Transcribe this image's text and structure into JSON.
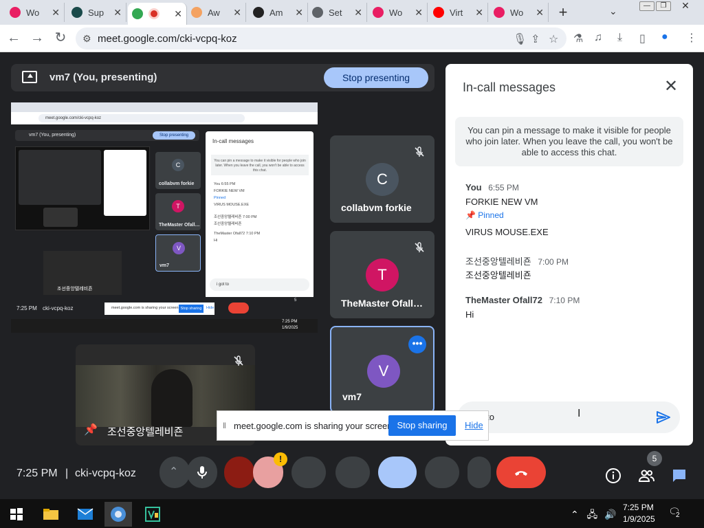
{
  "browser": {
    "tabs": [
      {
        "label": "Wo",
        "icon": "flower-icon",
        "color": "#e91e63"
      },
      {
        "label": "Sup",
        "icon": "chat-icon",
        "color": "#1a4a4a"
      },
      {
        "label": "",
        "icon": "meet-icon",
        "color": "#34a853"
      },
      {
        "label": "Aw",
        "icon": "rainbow-icon",
        "color": "#f4a261"
      },
      {
        "label": "Am",
        "icon": "amazon-icon",
        "color": "#222222"
      },
      {
        "label": "Set",
        "icon": "gear-icon",
        "color": "#5f6368"
      },
      {
        "label": "Wo",
        "icon": "flower-icon",
        "color": "#e91e63"
      },
      {
        "label": "Virt",
        "icon": "youtube-icon",
        "color": "#ff0000"
      },
      {
        "label": "Wo",
        "icon": "flower-icon",
        "color": "#e91e63"
      }
    ],
    "url": "meet.google.com/cki-vcpq-koz"
  },
  "meet": {
    "presenting_label": "vm7 (You, presenting)",
    "stop_presenting": "Stop presenting",
    "participants": [
      {
        "name": "collabvm forkie",
        "initial": "C",
        "color": "#4a5560"
      },
      {
        "name": "TheMaster Ofall…",
        "initial": "T",
        "color": "#d01563"
      },
      {
        "name": "vm7",
        "initial": "V",
        "color": "#7e57c2"
      }
    ],
    "video_caption": "조선중앙텔레비죤",
    "shared_screen": {
      "url": "meet.google.com/cki-vcpq-koz",
      "presenting_label": "vm7 (You, presenting)",
      "stop_presenting": "Stop presenting",
      "chat_title": "In-call messages",
      "chat_note": "You can pin a message to make it visible for people who join later. When you leave the call, you won't be able to access this chat.",
      "chat_lines": [
        "You  6:55 PM",
        "FORKIE NEW VM",
        "Pinned",
        "VIRUS MOUSE.EXE",
        "조선중앙텔레비죤  7:00 PM",
        "조선중앙텔레비죤",
        "TheMaster Ofall72  7:10 PM",
        "Hi"
      ],
      "chat_input": "i got to",
      "participants": [
        "collabvm forkie",
        "TheMaster Ofall…",
        "vm7"
      ],
      "clock": "7:25 PM",
      "meeting_code": "cki-vcpq-koz",
      "share_text": "meet.google.com is sharing your screen.",
      "stop_sharing": "Stop sharing",
      "hide": "Hide",
      "badge": "5",
      "tb_time": "7:25 PM",
      "tb_date": "1/9/2025",
      "video_caption": "조선중앙텔레비죤"
    },
    "chat": {
      "title": "In-call messages",
      "note": "You can pin a message to make it visible for people who join later. When you leave the call, you won't be able to access this chat.",
      "messages": [
        {
          "sender": "You",
          "time": "6:55 PM",
          "lines": [
            "FORKIE NEW VM"
          ],
          "pinned_label": "Pinned",
          "after_pin": "VIRUS MOUSE.EXE"
        },
        {
          "sender": "조선중앙텔레비죤",
          "time": "7:00 PM",
          "lines": [
            "조선중앙텔레비죤"
          ]
        },
        {
          "sender": "TheMaster Ofall72",
          "time": "7:10 PM",
          "lines": [
            "Hi"
          ]
        }
      ],
      "input_value": "i got to"
    },
    "bottom": {
      "clock": "7:25 PM",
      "meeting_code": "cki-vcpq-koz",
      "participant_count": "5"
    },
    "share_notice": {
      "text": "meet.google.com is sharing your screen.",
      "stop": "Stop sharing",
      "hide": "Hide"
    }
  },
  "taskbar": {
    "time": "7:25 PM",
    "date": "1/9/2025",
    "notifications": "2"
  }
}
